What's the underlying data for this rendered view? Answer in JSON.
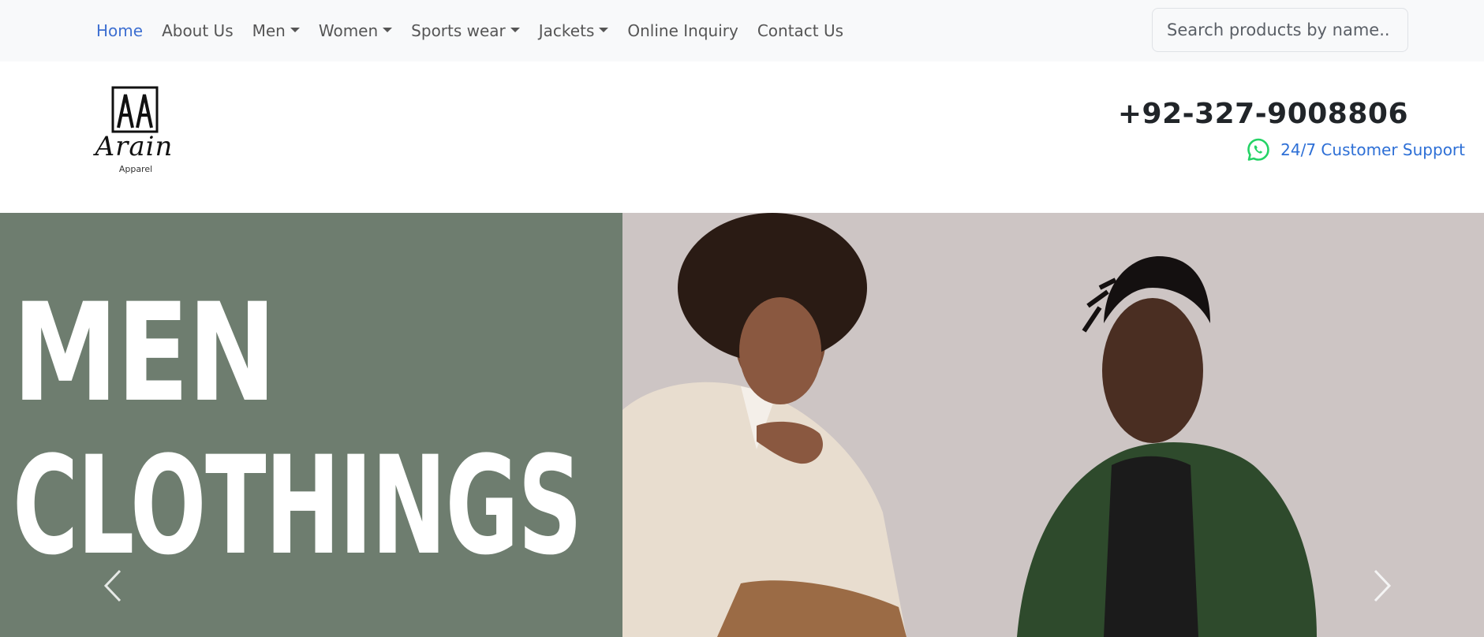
{
  "nav": {
    "items": [
      {
        "label": "Home",
        "active": true,
        "dropdown": false
      },
      {
        "label": "About Us",
        "active": false,
        "dropdown": false
      },
      {
        "label": "Men",
        "active": false,
        "dropdown": true
      },
      {
        "label": "Women",
        "active": false,
        "dropdown": true
      },
      {
        "label": "Sports wear",
        "active": false,
        "dropdown": true
      },
      {
        "label": "Jackets",
        "active": false,
        "dropdown": true
      },
      {
        "label": "Online Inquiry",
        "active": false,
        "dropdown": false
      },
      {
        "label": "Contact Us",
        "active": false,
        "dropdown": false
      }
    ]
  },
  "search": {
    "placeholder": "Search products by name.."
  },
  "header": {
    "logo": {
      "mark": "AA",
      "script": "Arain",
      "sub": "Apparel"
    },
    "phone": "+92-327-9008806",
    "support_label": "24/7 Customer Support"
  },
  "hero": {
    "line1": "MEN",
    "line2": "CLOTHINGS"
  },
  "icons": {
    "whatsapp": "whatsapp-icon",
    "prev": "chevron-left-icon",
    "next": "chevron-right-icon"
  },
  "colors": {
    "nav_bg": "#f8f9fa",
    "active_link": "#3d6fd1",
    "support_link": "#2d6fd6",
    "whatsapp": "#25d366",
    "hero_left_bg": "#6e7d6f",
    "hero_right_bg": "#cfc7c5"
  }
}
